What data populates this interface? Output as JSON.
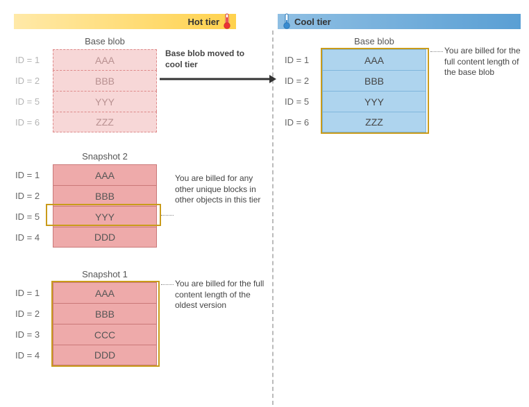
{
  "tiers": {
    "hot": "Hot tier",
    "cool": "Cool tier"
  },
  "baseBlobHot": {
    "title": "Base blob",
    "rows": [
      {
        "id": "ID = 1",
        "val": "AAA"
      },
      {
        "id": "ID = 2",
        "val": "BBB"
      },
      {
        "id": "ID = 5",
        "val": "YYY"
      },
      {
        "id": "ID = 6",
        "val": "ZZZ"
      }
    ]
  },
  "snapshot2": {
    "title": "Snapshot 2",
    "rows": [
      {
        "id": "ID = 1",
        "val": "AAA"
      },
      {
        "id": "ID = 2",
        "val": "BBB"
      },
      {
        "id": "ID = 5",
        "val": "YYY"
      },
      {
        "id": "ID = 4",
        "val": "DDD"
      }
    ]
  },
  "snapshot1": {
    "title": "Snapshot 1",
    "rows": [
      {
        "id": "ID = 1",
        "val": "AAA"
      },
      {
        "id": "ID = 2",
        "val": "BBB"
      },
      {
        "id": "ID = 3",
        "val": "CCC"
      },
      {
        "id": "ID = 4",
        "val": "DDD"
      }
    ]
  },
  "baseBlobCool": {
    "title": "Base blob",
    "rows": [
      {
        "id": "ID = 1",
        "val": "AAA"
      },
      {
        "id": "ID = 2",
        "val": "BBB"
      },
      {
        "id": "ID = 5",
        "val": "YYY"
      },
      {
        "id": "ID = 6",
        "val": "ZZZ"
      }
    ]
  },
  "annotations": {
    "moveLabel": "Base blob moved to cool tier",
    "coolBilling": "You are billed for the full content length of the base blob",
    "snap2Billing": "You are billed for any other unique blocks in other objects in this tier",
    "snap1Billing": "You are billed for the full content length of the oldest version"
  }
}
